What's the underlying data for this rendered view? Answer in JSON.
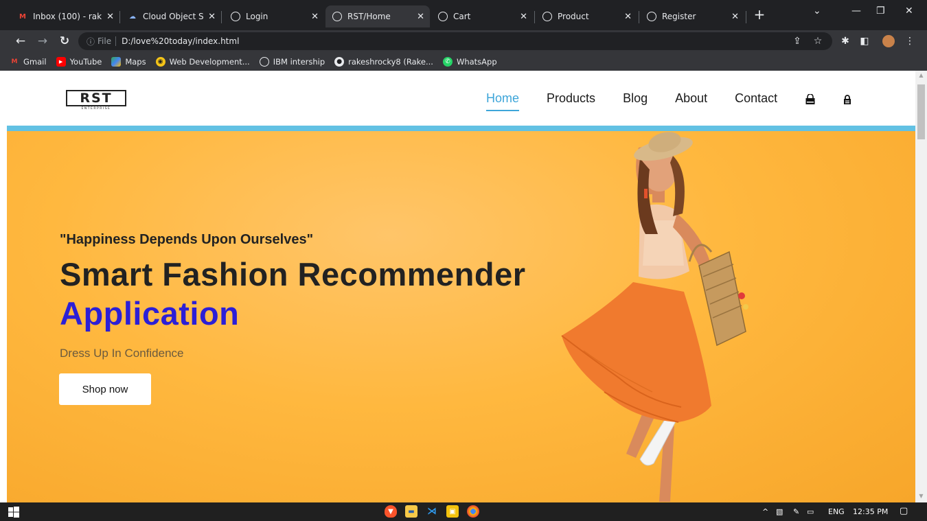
{
  "browser": {
    "tabs": [
      {
        "title": "Inbox (100) - rak",
        "favicon": "gmail-icon"
      },
      {
        "title": "Cloud Object Sto",
        "favicon": "cloud-icon"
      },
      {
        "title": "Login",
        "favicon": "globe-icon"
      },
      {
        "title": "RST/Home",
        "favicon": "globe-icon",
        "active": true
      },
      {
        "title": "Cart",
        "favicon": "globe-icon"
      },
      {
        "title": "Product",
        "favicon": "globe-icon"
      },
      {
        "title": "Register",
        "favicon": "globe-icon"
      }
    ],
    "address": {
      "file_label": "File",
      "url": "D:/love%20today/index.html"
    },
    "bookmarks": [
      {
        "label": "Gmail",
        "icon": "gmail-icon"
      },
      {
        "label": "YouTube",
        "icon": "youtube-icon"
      },
      {
        "label": "Maps",
        "icon": "maps-icon"
      },
      {
        "label": "Web Development...",
        "icon": "web-dev-icon"
      },
      {
        "label": "IBM intership",
        "icon": "globe-icon"
      },
      {
        "label": "rakeshrocky8 (Rake...",
        "icon": "github-icon"
      },
      {
        "label": "WhatsApp",
        "icon": "whatsapp-icon"
      }
    ]
  },
  "site": {
    "logo": {
      "text": "RST",
      "subtext": "ENTERPRISE"
    },
    "nav": [
      {
        "label": "Home",
        "active": true
      },
      {
        "label": "Products"
      },
      {
        "label": "Blog"
      },
      {
        "label": "About"
      },
      {
        "label": "Contact"
      }
    ],
    "nav_icons": [
      "shopping-bag-icon",
      "lock-icon"
    ],
    "hero": {
      "quote": "\"Happiness Depends Upon Ourselves\"",
      "title_line1": "Smart Fashion Recommender",
      "title_line2": "Application",
      "subtitle": "Dress Up In Confidence",
      "cta": "Shop now"
    }
  },
  "taskbar": {
    "apps": [
      "brave-icon",
      "file-explorer-icon",
      "vscode-icon",
      "notes-icon",
      "chrome-icon"
    ],
    "language": "ENG",
    "time": "12:35 PM"
  },
  "colors": {
    "accent": "#3da5d9",
    "hero_bg": "#ffb83f",
    "title_blue": "#2c1fd6",
    "nav_underline": "#62c1e3"
  }
}
